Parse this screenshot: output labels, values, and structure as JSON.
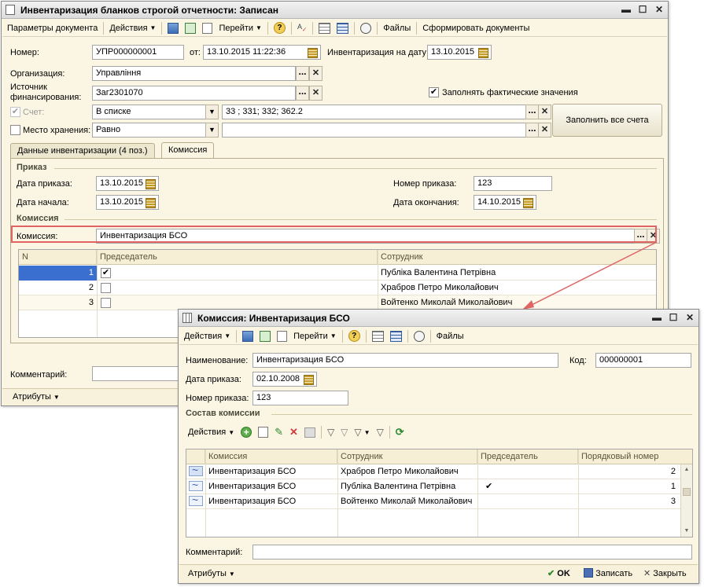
{
  "main": {
    "title": "Инвентаризация бланков строгой отчетности: Записан",
    "toolbar": {
      "params": "Параметры документа",
      "actions": "Действия",
      "goto": "Перейти",
      "files": "Файлы",
      "form_docs": "Сформировать документы"
    },
    "fields": {
      "number_label": "Номер:",
      "number": "УПР000000001",
      "from_label": "от:",
      "datetime": "13.10.2015 11:22:36",
      "inv_date_label": "Инвентаризация на дату:",
      "inv_date": "13.10.2015",
      "org_label": "Организация:",
      "org": "Управління",
      "source_label_1": "Источник",
      "source_label_2": "финансирования:",
      "source": "Заг2301070",
      "fill_actual_label": "Заполнять фактические значения",
      "fill_actual_checked": "✔",
      "account_label": "Счет:",
      "account_checked": "✔",
      "account_mode": "В списке",
      "account_value": "33 ; 331; 332; 362.2",
      "storage_label": "Место хранения:",
      "storage_checked": "",
      "storage_mode": "Равно",
      "storage_value": "",
      "fill_all_button": "Заполнить все счета"
    },
    "tabs": {
      "data_tab": "Данные инвентаризации (4 поз.)",
      "commission_tab": "Комиссия"
    },
    "order": {
      "section": "Приказ",
      "order_date_label": "Дата приказа:",
      "order_date": "13.10.2015",
      "start_date_label": "Дата начала:",
      "start_date": "13.10.2015",
      "order_num_label": "Номер приказа:",
      "order_num": "123",
      "end_date_label": "Дата окончания:",
      "end_date": "14.10.2015"
    },
    "commission": {
      "section": "Комиссия",
      "label": "Комиссия:",
      "value": "Инвентаризация БСО"
    },
    "grid": {
      "headers": [
        "N",
        "Председатель",
        "Сотрудник"
      ],
      "rows": [
        {
          "n": "1",
          "chair": "✔",
          "employee": "Публіка Валентина Петрівна"
        },
        {
          "n": "2",
          "chair": "",
          "employee": "Храбров Петро Миколайович"
        },
        {
          "n": "3",
          "chair": "",
          "employee": "Войтенко Миколай Миколайович"
        }
      ]
    },
    "comment_label": "Комментарий:",
    "attributes": "Атрибуты"
  },
  "commission_window": {
    "title": "Комиссия: Инвентаризация БСО",
    "toolbar": {
      "actions": "Действия",
      "goto": "Перейти",
      "files": "Файлы"
    },
    "fields": {
      "name_label": "Наименование:",
      "name": "Инвентаризация БСО",
      "code_label": "Код:",
      "code": "000000001",
      "order_date_label": "Дата приказа:",
      "order_date": "02.10.2008",
      "order_num_label": "Номер приказа:",
      "order_num": "123"
    },
    "section": "Состав комиссии",
    "sub_actions": "Действия",
    "grid": {
      "headers": [
        "Комиссия",
        "Сотрудник",
        "Председатель",
        "Порядковый номер"
      ],
      "rows": [
        {
          "commission": "Инвентаризация БСО",
          "employee": "Храбров Петро Миколайович",
          "chair": "",
          "order": "2"
        },
        {
          "commission": "Инвентаризация БСО",
          "employee": "Публіка Валентина Петрівна",
          "chair": "✔",
          "order": "1"
        },
        {
          "commission": "Инвентаризация БСО",
          "employee": "Войтенко Миколай Миколайович",
          "chair": "",
          "order": "3"
        }
      ]
    },
    "comment_label": "Комментарий:",
    "attributes": "Атрибуты",
    "ok": "OK",
    "save": "Записать",
    "close": "Закрыть"
  },
  "colors": {
    "window_bg": "#fbf6e4",
    "highlight": "#e06464",
    "selected_row": "#3a6fcf"
  }
}
